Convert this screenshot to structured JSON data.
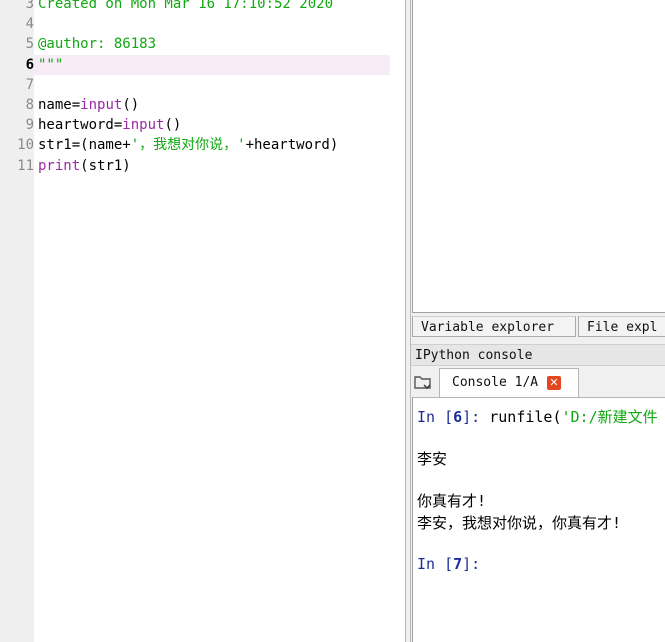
{
  "editor": {
    "lines": [
      {
        "num": "3",
        "parts": [
          {
            "text": "Created on Mon Mar 16 17:10:52 2020",
            "cls": "green"
          }
        ]
      },
      {
        "num": "4",
        "parts": []
      },
      {
        "num": "5",
        "parts": [
          {
            "text": "@author: 86183",
            "cls": "green"
          }
        ]
      },
      {
        "num": "6",
        "parts": [
          {
            "text": "\"\"\"",
            "cls": "green"
          }
        ],
        "current": true
      },
      {
        "num": "7",
        "parts": []
      },
      {
        "num": "8",
        "parts": [
          {
            "text": "name=",
            "cls": "black"
          },
          {
            "text": "input",
            "cls": "purple"
          },
          {
            "text": "()",
            "cls": "black"
          }
        ]
      },
      {
        "num": "9",
        "parts": [
          {
            "text": "heartword=",
            "cls": "black"
          },
          {
            "text": "input",
            "cls": "purple"
          },
          {
            "text": "()",
            "cls": "black"
          }
        ]
      },
      {
        "num": "10",
        "parts": [
          {
            "text": "str1=(name+",
            "cls": "black"
          },
          {
            "text": "'，我想对你说，'",
            "cls": "green"
          },
          {
            "text": "+heartword)",
            "cls": "black"
          }
        ]
      },
      {
        "num": "11",
        "parts": [
          {
            "text": "print",
            "cls": "purple"
          },
          {
            "text": "(str1)",
            "cls": "black"
          }
        ]
      }
    ]
  },
  "panes": {
    "tabs": [
      "Variable explorer",
      "File expl"
    ],
    "ipython_title": "IPython console",
    "console_tab_label": "Console 1/A"
  },
  "console": {
    "in6_prefix": "In [",
    "in6_num": "6",
    "in6_suffix": "]: ",
    "in6_cmd": "runfile(",
    "in6_arg": "'D:/新建文件",
    "out_line1": "李安",
    "out_line2": "你真有才!",
    "out_line3": "李安，我想对你说，你真有才!",
    "in7_prefix": "In [",
    "in7_num": "7",
    "in7_suffix": "]:"
  },
  "colors": {
    "string_green": "#11a811",
    "builtin_purple": "#9b29a7",
    "prompt_blue": "#1d2c9b",
    "current_line_highlight": "#f7ecf6",
    "close_tab_orange": "#e4471f"
  },
  "icons": [
    "folder-icon",
    "close-tab-icon"
  ]
}
